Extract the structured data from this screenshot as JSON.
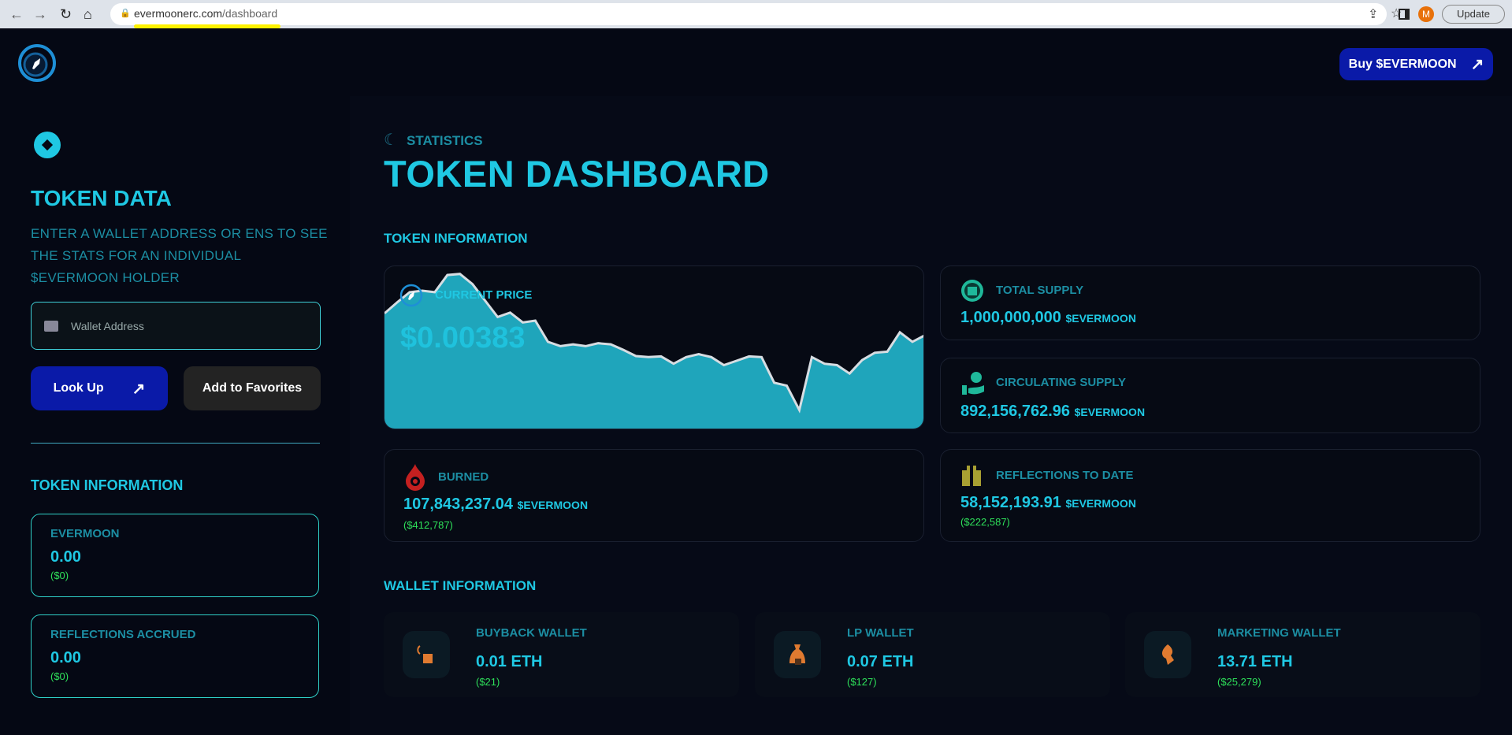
{
  "browser": {
    "url_domain": "evermoonerc.com",
    "url_path": "/dashboard",
    "update_label": "Update",
    "avatar_initial": "M"
  },
  "header": {
    "buy_label": "Buy $EVERMOON"
  },
  "sidebar": {
    "title": "TOKEN DATA",
    "description": "ENTER A WALLET ADDRESS OR ENS TO SEE THE STATS FOR AN INDIVIDUAL $EVERMOON HOLDER",
    "wallet_placeholder": "Wallet Address",
    "lookup_label": "Look Up",
    "favorites_label": "Add to Favorites",
    "section_title": "TOKEN INFORMATION",
    "cards": [
      {
        "label": "EVERMOON",
        "value": "0.00",
        "usd": "($0)"
      },
      {
        "label": "REFLECTIONS ACCRUED",
        "value": "0.00",
        "usd": "($0)"
      }
    ]
  },
  "main": {
    "eyebrow": "STATISTICS",
    "title": "TOKEN DASHBOARD",
    "token_info_title": "TOKEN INFORMATION",
    "price": {
      "label": "CURRENT PRICE",
      "value": "$0.00383"
    },
    "total_supply": {
      "label": "TOTAL SUPPLY",
      "value": "1,000,000,000",
      "unit": "$EVERMOON"
    },
    "circulating_supply": {
      "label": "CIRCULATING SUPPLY",
      "value": "892,156,762.96",
      "unit": "$EVERMOON"
    },
    "burned": {
      "label": "BURNED",
      "value": "107,843,237.04",
      "unit": "$EVERMOON",
      "usd": "($412,787)"
    },
    "reflections": {
      "label": "REFLECTIONS TO DATE",
      "value": "58,152,193.91",
      "unit": "$EVERMOON",
      "usd": "($222,587)"
    },
    "wallet_info_title": "WALLET INFORMATION",
    "wallets": [
      {
        "label": "BUYBACK WALLET",
        "value": "0.01 ETH",
        "usd": "($21)"
      },
      {
        "label": "LP WALLET",
        "value": "0.07 ETH",
        "usd": "($127)"
      },
      {
        "label": "MARKETING WALLET",
        "value": "13.71 ETH",
        "usd": "($25,279)"
      }
    ]
  },
  "chart_data": {
    "type": "area",
    "fill": "#1fa5bb",
    "line": "#d6dde2",
    "values": [
      320,
      350,
      378,
      382,
      378,
      425,
      428,
      400,
      355,
      310,
      322,
      295,
      300,
      242,
      230,
      235,
      230,
      238,
      235,
      220,
      203,
      200,
      202,
      182,
      200,
      208,
      200,
      178,
      190,
      202,
      200,
      130,
      122,
      55,
      200,
      182,
      178,
      155,
      192,
      212,
      215,
      268,
      242,
      260
    ]
  }
}
